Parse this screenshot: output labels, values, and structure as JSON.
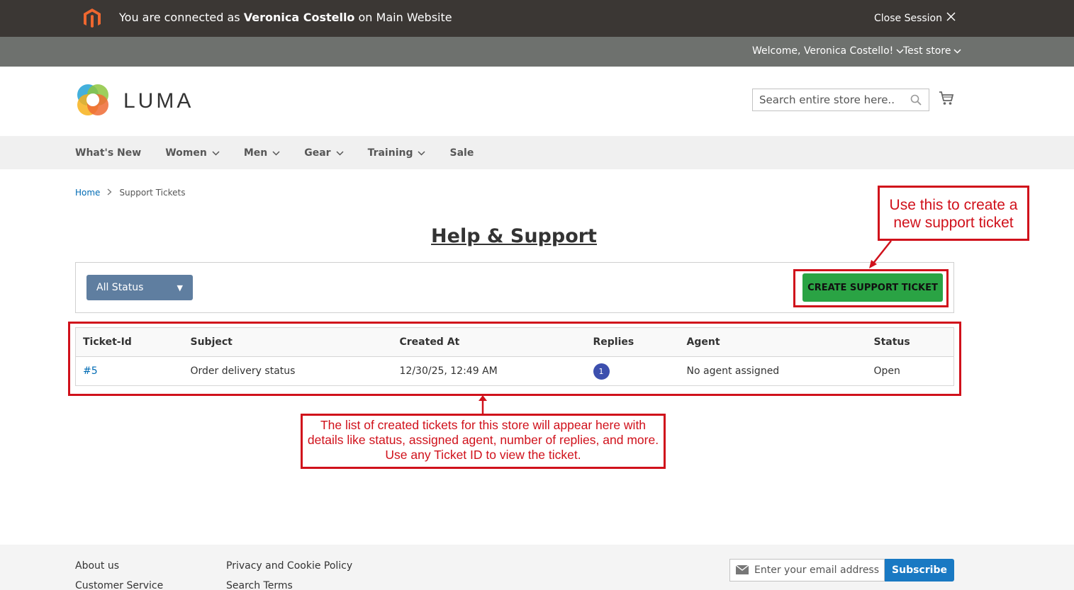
{
  "impersonation": {
    "prefix": "You are connected as",
    "name": "Veronica Costello",
    "suffix": "on Main Website",
    "close_label": "Close Session"
  },
  "panel": {
    "welcome": "Welcome, Veronica Costello!",
    "store": "Test store"
  },
  "header": {
    "brand": "LUMA",
    "search_placeholder": "Search entire store here..."
  },
  "nav": {
    "items": [
      {
        "label": "What's New",
        "has_dropdown": false
      },
      {
        "label": "Women",
        "has_dropdown": true
      },
      {
        "label": "Men",
        "has_dropdown": true
      },
      {
        "label": "Gear",
        "has_dropdown": true
      },
      {
        "label": "Training",
        "has_dropdown": true
      },
      {
        "label": "Sale",
        "has_dropdown": false
      }
    ]
  },
  "breadcrumb": {
    "home": "Home",
    "current": "Support Tickets"
  },
  "page": {
    "title": "Help & Support",
    "status_filter": "All Status",
    "create_button": "CREATE SUPPORT TICKET"
  },
  "table": {
    "headers": [
      "Ticket-Id",
      "Subject",
      "Created At",
      "Replies",
      "Agent",
      "Status"
    ],
    "rows": [
      {
        "id": "#5",
        "subject": "Order delivery status",
        "created_at": "12/30/25, 12:49 AM",
        "replies": "1",
        "agent": "No agent assigned",
        "status": "Open"
      }
    ]
  },
  "annotations": {
    "create_note": "Use this to create a new support ticket",
    "list_note": "The list of created tickets for this store will appear here with details like status, assigned agent, number of replies, and more. Use any Ticket ID to view the ticket."
  },
  "footer": {
    "col1": [
      "About us",
      "Customer Service"
    ],
    "col2": [
      "Privacy and Cookie Policy",
      "Search Terms"
    ],
    "newsletter_placeholder": "Enter your email address",
    "subscribe_label": "Subscribe"
  },
  "colors": {
    "impersonation_bar": "#3b3734",
    "panel": "#6e716e",
    "create_button": "#2aa344",
    "status_select": "#5f7ea0",
    "annotation": "#d0111b",
    "subscribe": "#1979c3",
    "link": "#006bb4"
  }
}
